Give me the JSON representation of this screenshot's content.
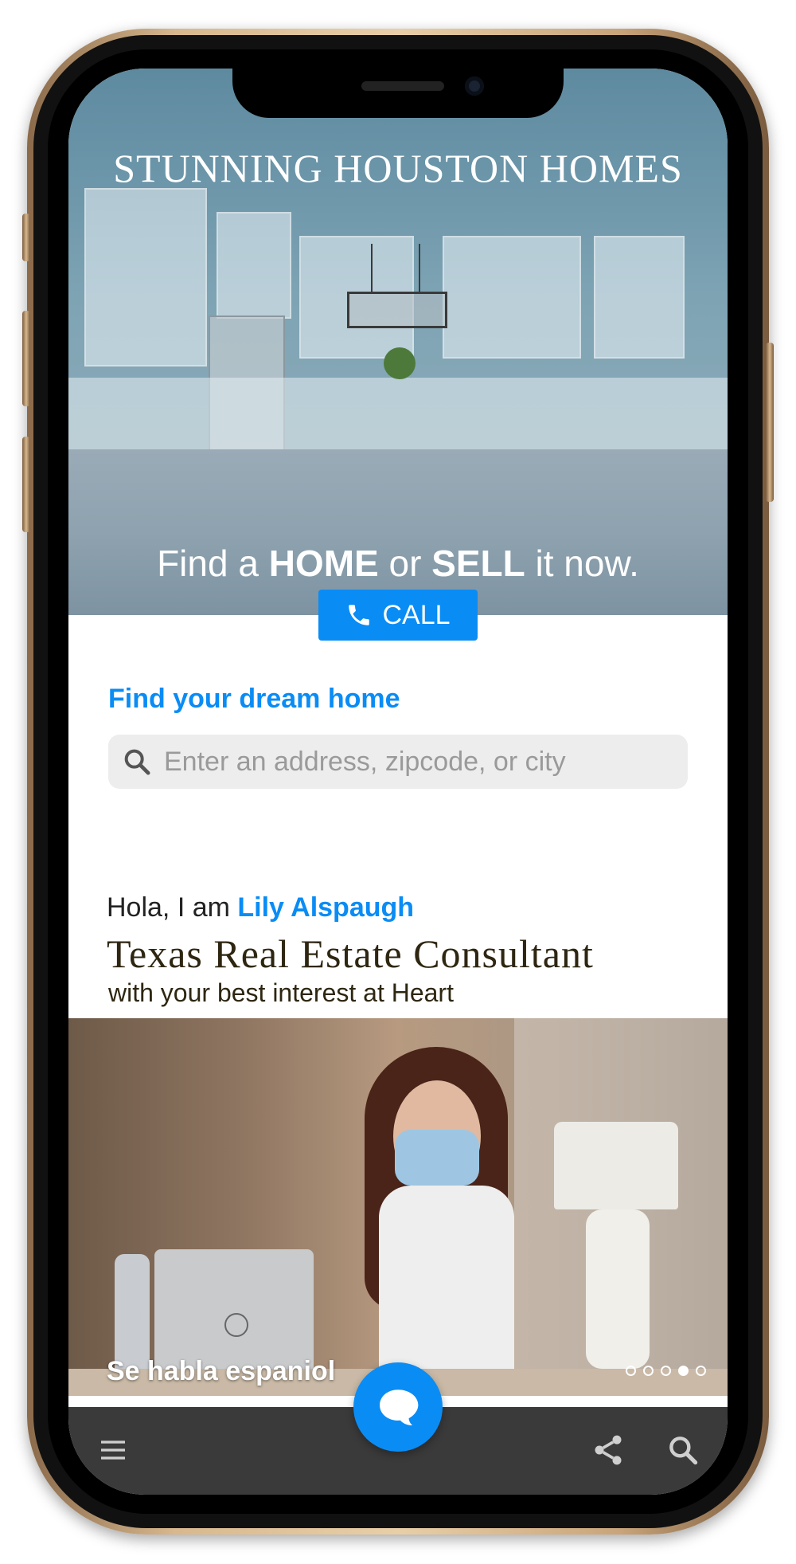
{
  "hero": {
    "title": "STUNNING HOUSTON HOMES",
    "tagline_pre": "Find a ",
    "tagline_home": "HOME",
    "tagline_mid": " or ",
    "tagline_sell": "SELL",
    "tagline_post": " it now.",
    "call_label": "CALL"
  },
  "search": {
    "title": "Find your dream home",
    "placeholder": "Enter an address, zipcode, or city"
  },
  "agent": {
    "greeting": "Hola, I am ",
    "name": "Lily Alspaugh",
    "role": "Texas Real Estate Consultant",
    "tagline": "with your best interest at Heart"
  },
  "carousel": {
    "caption": "Se habla espaniol",
    "total_slides": 5,
    "active_slide": 4
  },
  "bottom_nav": {
    "icons": [
      "menu-icon",
      "chat-icon",
      "share-icon",
      "search-icon"
    ]
  },
  "colors": {
    "accent": "#0a8cf5",
    "bar": "#3a3a3a",
    "heading_dark": "#2e2611"
  }
}
